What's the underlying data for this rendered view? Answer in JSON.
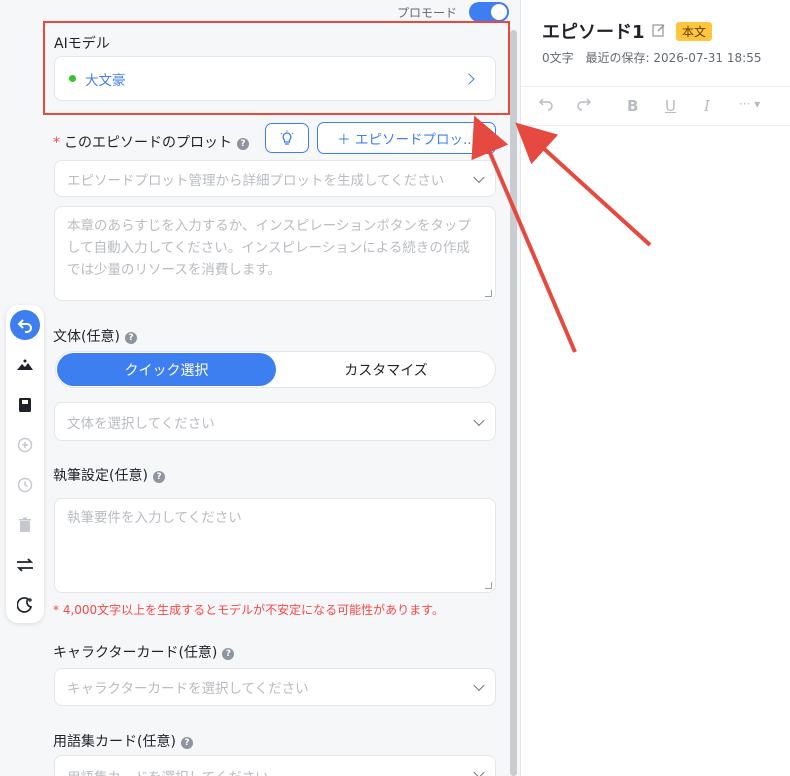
{
  "header": {
    "pro_mode_label": "プロモード"
  },
  "ai_model": {
    "label": "AIモデル",
    "name": "大文豪",
    "status_color": "#34c724"
  },
  "plot": {
    "label": "このエピソードのプロット",
    "add_button": "＋ エピソードプロッ...",
    "select_placeholder": "エピソードプロット管理から詳細プロットを生成してください",
    "textarea_placeholder": "本章のあらすじを入力するか、インスピレーションボタンをタップして自動入力してください。インスピレーションによる続きの作成では少量のリソースを消費します。"
  },
  "style": {
    "label": "文体(任意)",
    "tab_quick": "クイック選択",
    "tab_custom": "カスタマイズ",
    "select_placeholder": "文体を選択してください"
  },
  "writing": {
    "label": "執筆設定(任意)",
    "placeholder": "執筆要件を入力してください",
    "warning": "* 4,000文字以上を生成するとモデルが不安定になる可能性があります。"
  },
  "character": {
    "label": "キャラクターカード(任意)",
    "placeholder": "キャラクターカードを選択してください"
  },
  "glossary": {
    "label": "用語集カード(任意)",
    "placeholder": "用語集カードを選択してください"
  },
  "editor": {
    "title": "エピソード1",
    "badge": "本文",
    "char_count": "0文字",
    "saved": "最近の保存: 2026-07-31 18:55"
  },
  "icons": [
    "back-icon",
    "inspiration-icon",
    "book-icon",
    "add-circle-icon",
    "history-icon",
    "trash-icon",
    "swap-icon",
    "moon-icon",
    "lightbulb-icon",
    "edit-icon",
    "undo-icon",
    "redo-icon",
    "bold-icon",
    "underline-icon",
    "italic-icon",
    "more-icon"
  ],
  "colors": {
    "accent": "#3d7ff0",
    "highlight": "#e5493f",
    "badge": "#ffc53d",
    "warning": "#f54a45"
  }
}
